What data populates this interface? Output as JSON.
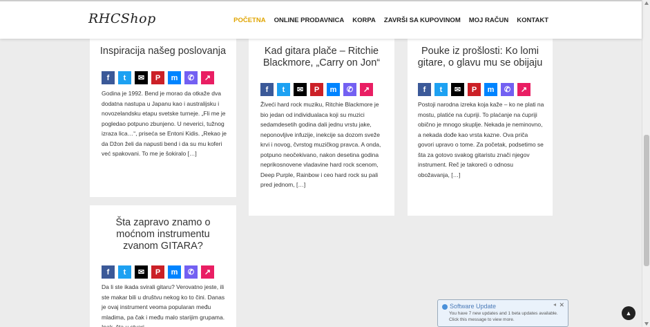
{
  "header": {
    "logo": "RHCShop",
    "nav": [
      "POČETNA",
      "ONLINE PRODAVNICA",
      "KORPA",
      "ZAVRŠI SA KUPOVINOM",
      "MOJ RAČUN",
      "KONTAKT"
    ],
    "active_color": "#e0a400"
  },
  "share_icons": [
    {
      "name": "facebook-icon",
      "glyph": "f",
      "color": "#3b5998"
    },
    {
      "name": "twitter-icon",
      "glyph": "t",
      "color": "#1da1f2"
    },
    {
      "name": "email-icon",
      "glyph": "✉",
      "color": "#000000"
    },
    {
      "name": "pinterest-icon",
      "glyph": "P",
      "color": "#cb2027"
    },
    {
      "name": "messenger-icon",
      "glyph": "m",
      "color": "#0084ff"
    },
    {
      "name": "viber-icon",
      "glyph": "✆",
      "color": "#7360f2"
    },
    {
      "name": "share-icon",
      "glyph": "↗",
      "color": "#e91e63"
    }
  ],
  "posts": [
    {
      "title": "Inspiracija našeg poslovanja",
      "excerpt": "Godina je 1992. Bend je morao da otkaže dva dodatna nastupa u Japanu kao i australijsku i novozelandsku etapu svetske turneje. „Fli me je pogledao potpuno zbunjeno. U neverici, tužnog izraza lica…“, priseća se Entoni Kidis. „Rekao je da Džon želi da napusti bend i da su mu koferi već spakovani. To me je šokiralo […]"
    },
    {
      "title": "Kad gitara plače – Ritchie Blackmore, „Carry on Jon“",
      "excerpt": "Živeći hard rock muziku, Ritchie Blackmore je bio jedan od individualaca koji su muzici sedamdesetih godina dali jednu vrstu jake, neponovljive infuzije, inekcije sa dozom sveže krvi i novog, čvrstog muzičkog pravca. A onda, potpuno neočekivano, nakon desetina godina neprikosnovene vladavine hard rock scenom, Deep Purple, Rainbow i ceo hard rock su pali pred jednom, […]"
    },
    {
      "title": "Pouke iz prošlosti: Ko lomi gitare, o glavu mu se obijaju",
      "excerpt": "Postoji narodna izreka koja kaže – ko ne plati na mostu, platiće na ćupriji. To plaćanje na ćupriji obično je mnogo skuplje. Nekada je neminovno, a nekada dođe kao vrsta kazne. Ova priča govori upravo o tome. Za početak, podsetimo se šta za gotovo svakog gitaristu znači njegov instrument. Reč je takoreći o odnosu obožavanja, […]"
    },
    {
      "title": "Šta zapravo znamo o moćnom instrumentu zvanom GITARA?",
      "excerpt": "Da li ste ikada svirali gitaru? Verovatno jeste, ili ste makar bili u društvu nekog ko to čini. Danas je ovaj instrument veoma popularan među mladima, pa čak i među malo starijim grupama. Ipak, šta u stvari"
    }
  ],
  "popup": {
    "title": "Software Update",
    "message": "You have 7 new updates and 1 beta updates available. Click this message to view more.",
    "close": "✕",
    "minimize": "◂"
  },
  "back_to_top": "▲"
}
